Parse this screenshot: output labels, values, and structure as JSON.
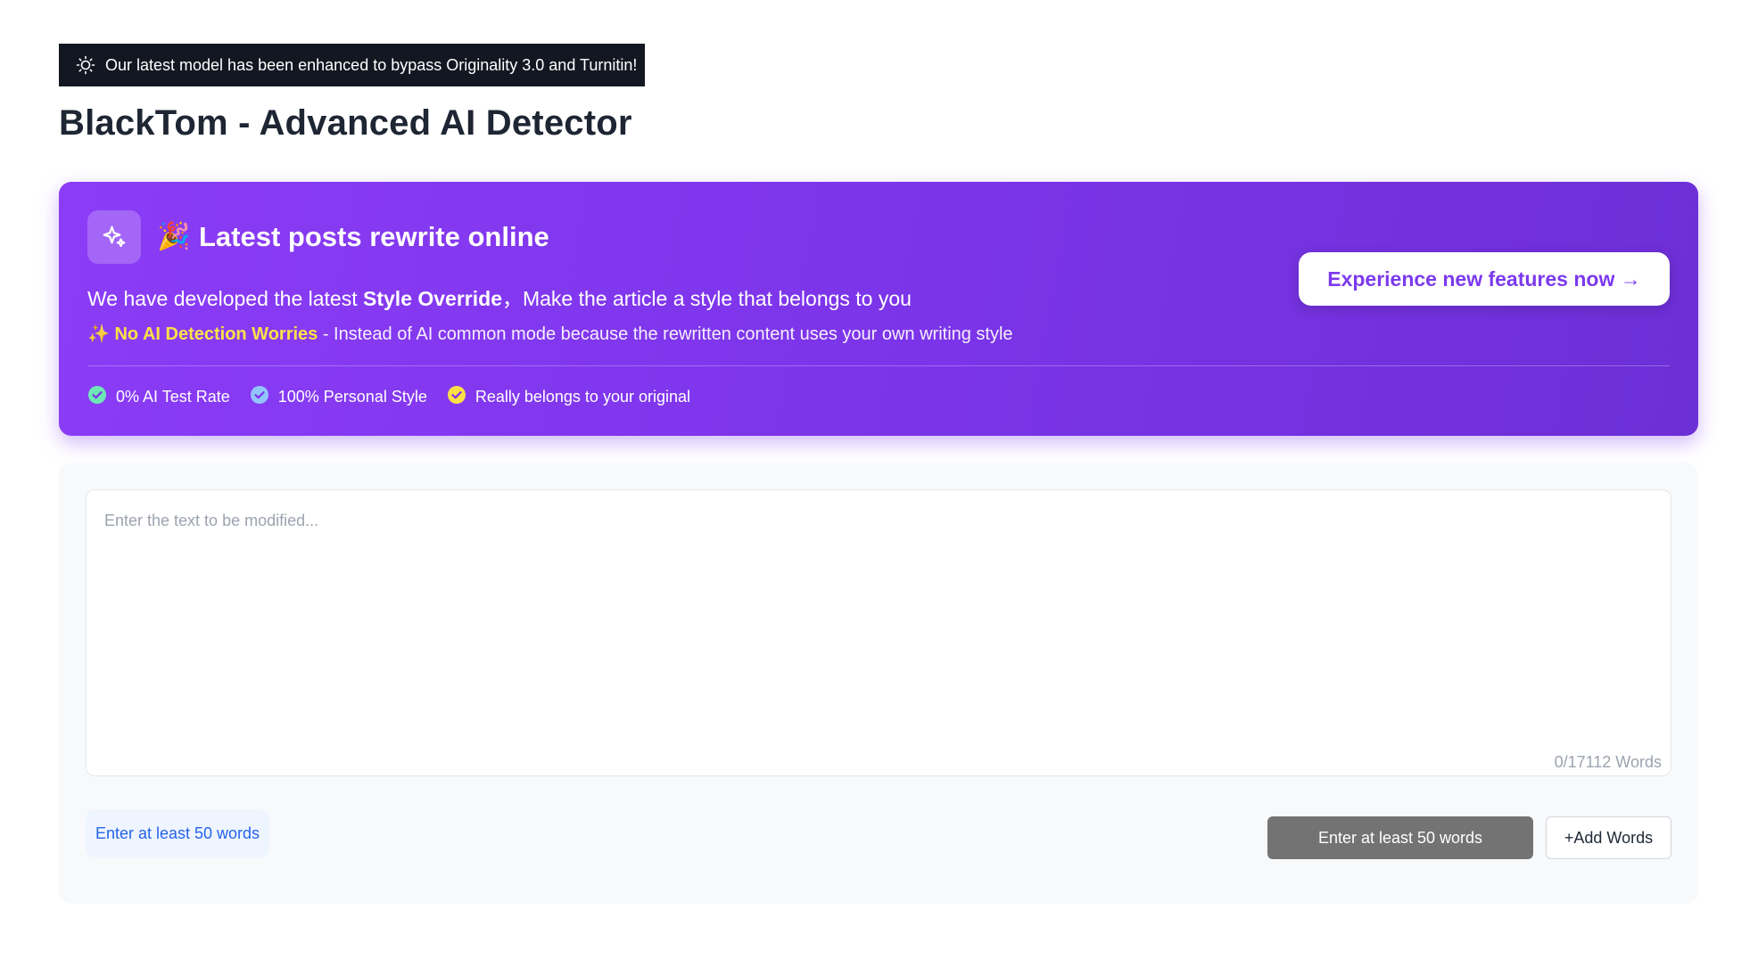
{
  "notice": {
    "icon": "lightbulb-icon",
    "text": "Our latest model has been enhanced to bypass Originality 3.0 and Turnitin!"
  },
  "page": {
    "title": "BlackTom - Advanced AI Detector"
  },
  "promo": {
    "icon": "sparkles-icon",
    "emoji": "🎉",
    "title": "Latest posts rewrite online",
    "line1_prefix": "We have developed the latest ",
    "line1_bold": "Style Override",
    "line1_suffix": "，Make the article a style that belongs to you",
    "line2_emoji": "✨",
    "line2_highlight": "No AI Detection Worries",
    "line2_text": " - Instead of AI common mode because the rewritten content uses your own writing style",
    "features": [
      {
        "label": "0% AI Test Rate",
        "icon_color": "#6ee7b7"
      },
      {
        "label": "100% Personal Style",
        "icon_color": "#93c5fd"
      },
      {
        "label": "Really belongs to your original",
        "icon_color": "#fde047"
      }
    ],
    "cta_label": "Experience new features now →"
  },
  "editor": {
    "placeholder": "Enter the text to be modified...",
    "value": "",
    "word_count": "0/17112 Words"
  },
  "actions": {
    "hint": "Enter at least 50 words",
    "submit_label": "Enter at least 50 words",
    "add_words_label": "+Add Words"
  },
  "colors": {
    "accent": "#7c3aed",
    "promo_gradient_start": "#8b3cf6",
    "promo_gradient_end": "#6d2fd6",
    "highlight": "#fde047",
    "hint_text": "#2563eb"
  }
}
